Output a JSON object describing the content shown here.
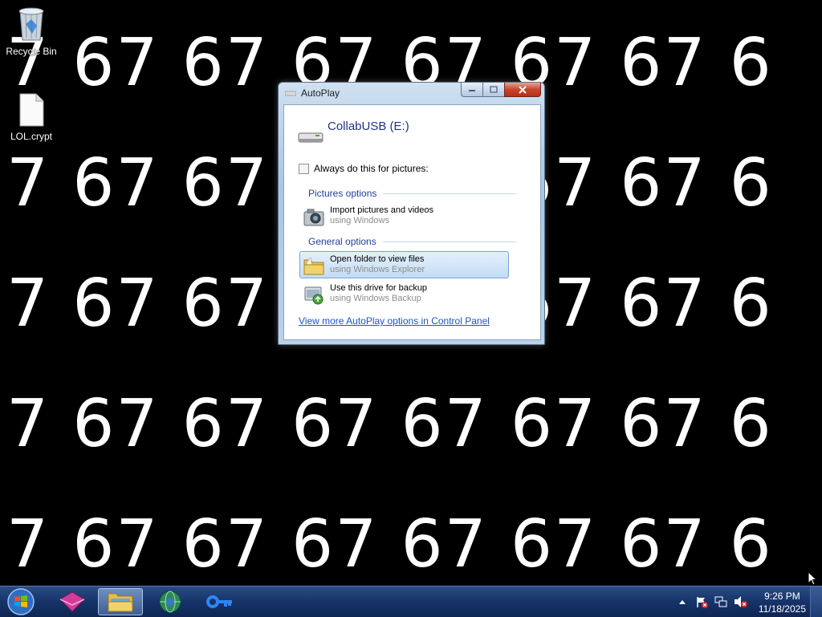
{
  "wallpaper": {
    "text_token": "67",
    "rows": [
      "7  67  67  67  67  67  67  6",
      "7  67  67  67  67  67  67  6",
      "7  67  67  67  67  67  67  6",
      "7  67  67  67  67  67  67  6",
      "7  67  67  67  67  67  67  6"
    ]
  },
  "desktop": {
    "icons": [
      {
        "label": "Recycle Bin",
        "icon": "recycle-bin-icon"
      },
      {
        "label": "LOL.crypt",
        "icon": "file-icon"
      }
    ]
  },
  "dialog": {
    "title": "AutoPlay",
    "drive_name": "CollabUSB (E:)",
    "always_checkbox_label": "Always do this for pictures:",
    "always_checked": false,
    "sections": {
      "pictures": "Pictures options",
      "general": "General options"
    },
    "options": [
      {
        "main": "Import pictures and videos",
        "sub": "using Windows",
        "icon": "camera-icon",
        "selected": false
      },
      {
        "main": "Open folder to view files",
        "sub": "using Windows Explorer",
        "icon": "folder-icon",
        "selected": true
      },
      {
        "main": "Use this drive for backup",
        "sub": "using Windows Backup",
        "icon": "backup-icon",
        "selected": false
      }
    ],
    "more_link": "View more AutoPlay options in Control Panel"
  },
  "taskbar": {
    "buttons": [
      {
        "name": "start-button",
        "icon": "windows-logo-icon"
      },
      {
        "name": "app-button",
        "icon": "magenta-box-icon"
      },
      {
        "name": "explorer-button",
        "icon": "folder-icon",
        "active": true
      },
      {
        "name": "browser-button",
        "icon": "globe-icon"
      },
      {
        "name": "key-app-button",
        "icon": "key-icon"
      }
    ],
    "tray_icons": [
      "show-hidden-icons-icon",
      "action-center-flag-icon",
      "network-icon",
      "volume-muted-icon"
    ],
    "time": "9:26 PM",
    "date": "11/18/2025"
  },
  "colors": {
    "wallpaper_bg": "#000000",
    "wallpaper_text": "#ffffff",
    "link": "#1a55c9",
    "section_heading": "#1e3f9a",
    "taskbar": "#163369"
  }
}
